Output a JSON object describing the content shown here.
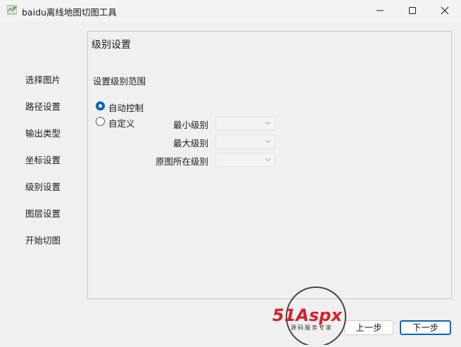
{
  "window": {
    "title": "baidu离线地图切图工具"
  },
  "sidebar": {
    "items": [
      {
        "label": "选择图片"
      },
      {
        "label": "路径设置"
      },
      {
        "label": "输出类型"
      },
      {
        "label": "坐标设置"
      },
      {
        "label": "级别设置"
      },
      {
        "label": "图层设置"
      },
      {
        "label": "开始切图"
      }
    ]
  },
  "main": {
    "title": "级别设置",
    "range_label": "设置级别范围",
    "mode": {
      "options": [
        {
          "label": "自动控制",
          "checked": true
        },
        {
          "label": "自定义",
          "checked": false
        }
      ]
    },
    "levels": {
      "min_label": "最小级别",
      "min_value": "",
      "max_label": "最大级别",
      "max_value": "",
      "orig_label": "原图所在级别",
      "orig_value": ""
    }
  },
  "footer": {
    "prev_label": "上一步",
    "next_label": "下一步"
  },
  "watermark": {
    "brand": "51Aspx",
    "tagline": "源码服务专家"
  },
  "colors": {
    "accent": "#0067c0",
    "watermark_red": "#d3222a",
    "watermark_green": "#3a9a3a"
  }
}
